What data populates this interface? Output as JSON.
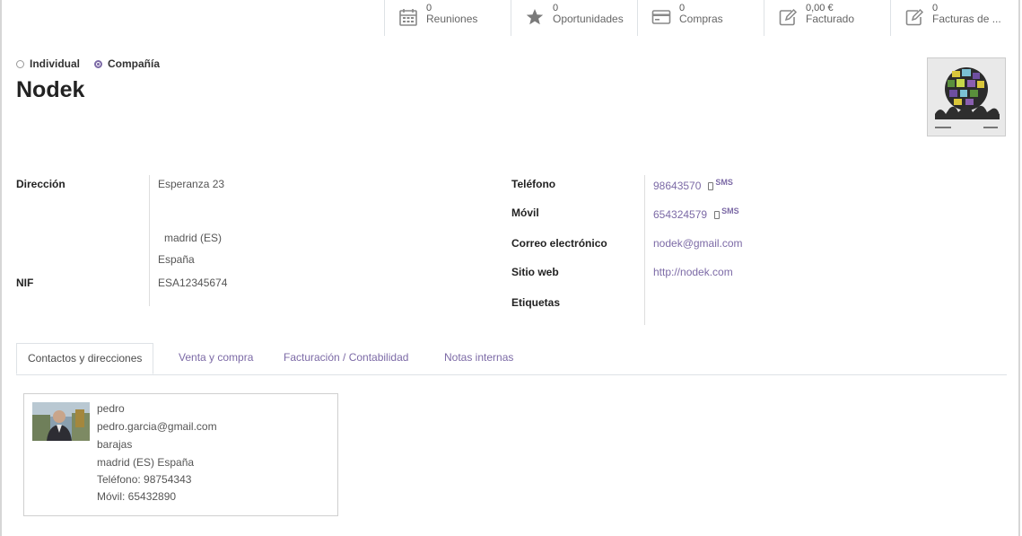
{
  "stats": [
    {
      "value": "0",
      "label": "Reuniones",
      "icon": "calendar-icon"
    },
    {
      "value": "0",
      "label": "Oportunidades",
      "icon": "star-icon"
    },
    {
      "value": "0",
      "label": "Compras",
      "icon": "credit-card-icon"
    },
    {
      "value": "0,00 €",
      "label": "Facturado",
      "icon": "edit-icon"
    },
    {
      "value": "0",
      "label": "Facturas de ...",
      "icon": "edit-icon"
    }
  ],
  "company_type": {
    "individual": "Individual",
    "company": "Compañía",
    "selected": "company"
  },
  "partner_name": "Nodek",
  "fields": {
    "address_label": "Dirección",
    "street": "Esperanza 23",
    "city_state": "madrid (ES)",
    "country": "España",
    "vat_label": "NIF",
    "vat": "ESA12345674",
    "phone_label": "Teléfono",
    "phone": "98643570",
    "mobile_label": "Móvil",
    "mobile": "654324579",
    "sms": "SMS",
    "email_label": "Correo electrónico",
    "email": "nodek@gmail.com",
    "website_label": "Sitio web",
    "website": "http://nodek.com",
    "tags_label": "Etiquetas"
  },
  "tabs": [
    {
      "label": "Contactos y direcciones",
      "active": true
    },
    {
      "label": "Venta y compra",
      "active": false
    },
    {
      "label": "Facturación / Contabilidad",
      "active": false
    },
    {
      "label": "Notas internas",
      "active": false
    }
  ],
  "contact_card": {
    "name": "pedro",
    "email": "pedro.garcia@gmail.com",
    "street": "barajas",
    "city": "madrid (ES) España",
    "phone": "Teléfono: 98754343",
    "mobile": "Móvil: 65432890"
  },
  "colors": {
    "accent": "#7c6aa6",
    "label": "#222222",
    "text": "#555555",
    "border": "#dee2e6"
  }
}
